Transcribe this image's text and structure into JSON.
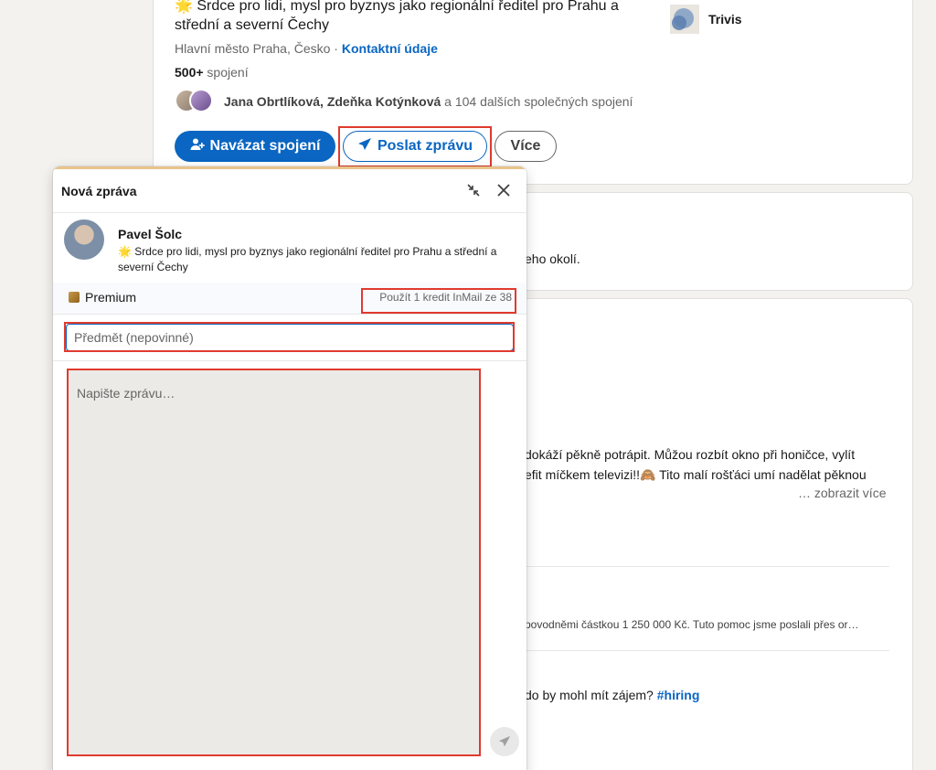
{
  "profile": {
    "headline_line1": "🌟 Srdce pro lidi, mysl pro byznys jako regionální ředitel pro Prahu a",
    "headline_line2": "střední a severní Čechy",
    "location": "Hlavní město Praha, Česko",
    "location_separator": " · ",
    "contact_link": "Kontaktní údaje",
    "connections_count": "500+",
    "connections_label": " spojení",
    "mutual_names": "Jana Obrtlíková, Zdeňka Kotýnková",
    "mutual_rest": " a 104 dalších společných spojení",
    "company": "Trivis",
    "buttons": {
      "connect": "Navázat spojení",
      "message": "Poslat zprávu",
      "more": "Více"
    }
  },
  "background": {
    "card2_text": "eho okolí.",
    "post_line1": "dokáží pěkně potrápit. Můžou rozbít okno při honičce, vylít",
    "post_line2": "efit míčkem televizi!!🙈 Tito malí rošťáci umí nadělat pěknou",
    "show_more": "… zobrazit více",
    "post2_text": "povodněmi částkou 1 250 000 Kč. Tuto pomoc jsme poslali přes or…",
    "post3_text": "do by mohl mít zájem? ",
    "post3_hashtag": "#hiring"
  },
  "modal": {
    "title": "Nová zpráva",
    "recipient_name": "Pavel Šolc",
    "recipient_headline": "🌟 Srdce pro lidi, mysl pro byznys jako regionální ředitel pro Prahu a střední a severní Čechy",
    "premium_label": "Premium",
    "inmail_info": "Použít 1 kredit InMail ze 38",
    "subject_placeholder": "Předmět (nepovinné)",
    "message_placeholder": "Napište zprávu…"
  },
  "icons": {
    "collapse": "collapse-icon",
    "close": "close-icon",
    "send": "send-icon",
    "add_person": "add-person-icon",
    "paper_plane": "paper-plane-icon"
  },
  "colors": {
    "brand_blue": "#0a66c2",
    "highlight_red": "#e03a2e",
    "premium_gold": "#e7c38a"
  }
}
